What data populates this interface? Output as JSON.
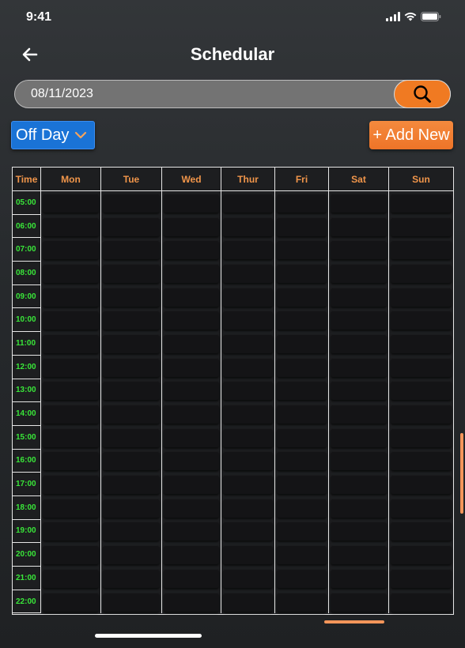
{
  "status_bar": {
    "time": "9:41",
    "icons": [
      "signal-icon",
      "wifi-icon",
      "battery-icon"
    ]
  },
  "header": {
    "title": "Schedular",
    "back_icon": "arrow-left-icon"
  },
  "search": {
    "value": "08/11/2023",
    "button_icon": "search-icon"
  },
  "controls": {
    "offday_label": "Off Day",
    "offday_icon": "chevron-down-icon",
    "add_new_label": "+ Add New"
  },
  "schedule": {
    "columns": [
      "Time",
      "Mon",
      "Tue",
      "Wed",
      "Thur",
      "Fri",
      "Sat",
      "Sun"
    ],
    "times": [
      "05:00",
      "06:00",
      "07:00",
      "08:00",
      "09:00",
      "10:00",
      "11:00",
      "12:00",
      "13:00",
      "14:00",
      "15:00",
      "16:00",
      "17:00",
      "18:00",
      "19:00",
      "20:00",
      "21:00",
      "22:00"
    ]
  },
  "colors": {
    "accent_orange": "#f07a22",
    "offday_blue": "#1a73d6",
    "time_green": "#39e639",
    "header_text_orange": "#f0954a"
  }
}
